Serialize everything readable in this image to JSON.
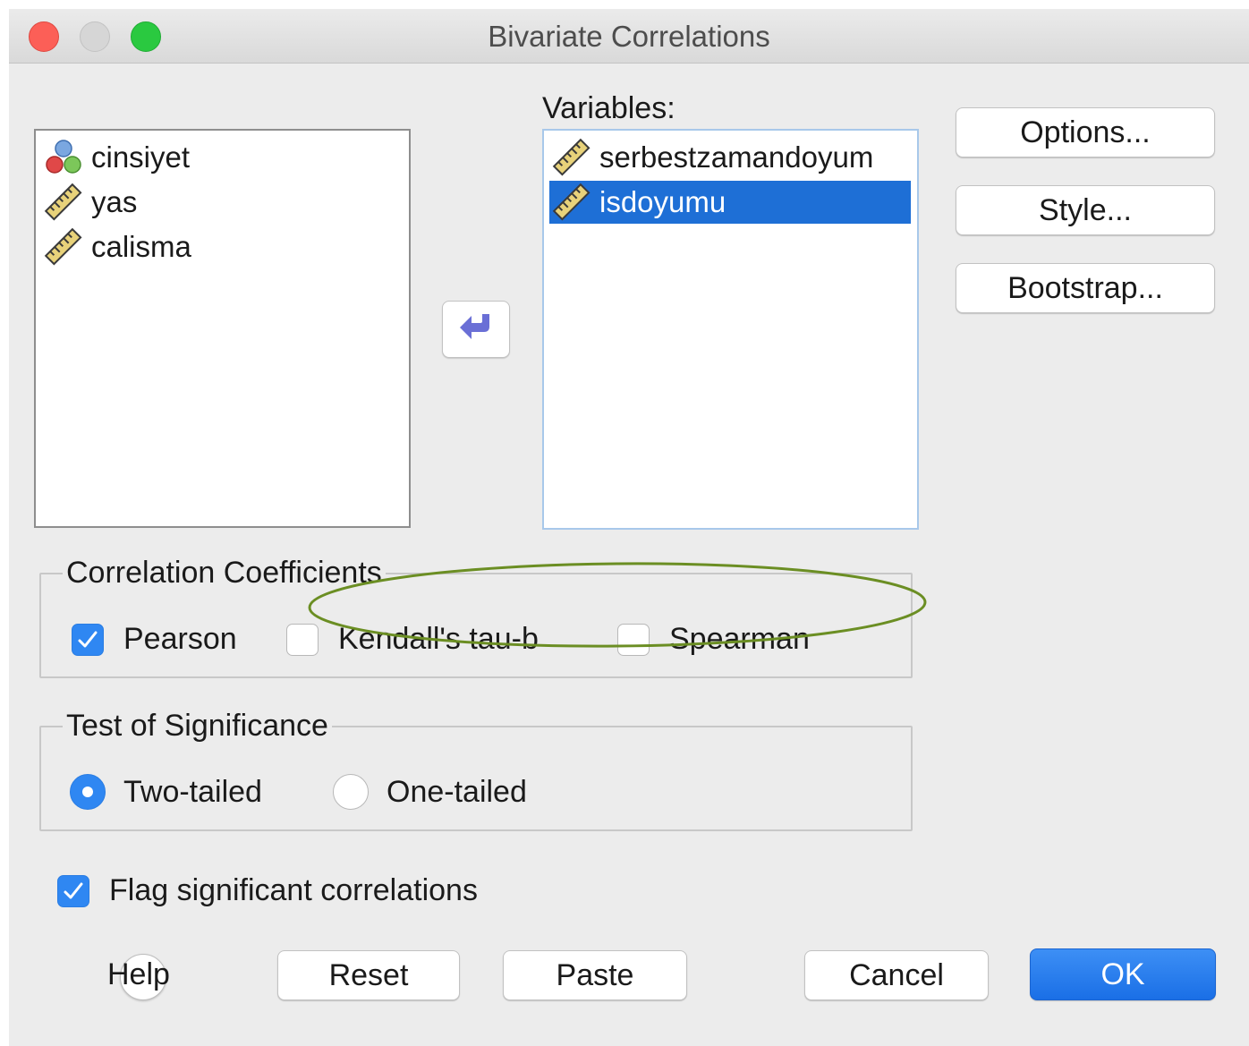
{
  "window": {
    "title": "Bivariate Correlations"
  },
  "source_list": {
    "items": [
      {
        "label": "cinsiyet",
        "icon": "nominal-variable-icon"
      },
      {
        "label": "yas",
        "icon": "scale-ruler-icon"
      },
      {
        "label": "calisma",
        "icon": "scale-ruler-icon"
      }
    ]
  },
  "variables_list": {
    "label": "Variables:",
    "items": [
      {
        "label": "serbestzamandoyum",
        "icon": "scale-ruler-icon",
        "selected": false
      },
      {
        "label": "isdoyumu",
        "icon": "scale-ruler-icon",
        "selected": true
      }
    ]
  },
  "side_buttons": {
    "options": "Options...",
    "style": "Style...",
    "bootstrap": "Bootstrap..."
  },
  "correlation_coefficients": {
    "title": "Correlation Coefficients",
    "pearson": {
      "label": "Pearson",
      "checked": true
    },
    "kendall": {
      "label": "Kendall's tau-b",
      "checked": false
    },
    "spearman": {
      "label": "Spearman",
      "checked": false
    }
  },
  "test_of_significance": {
    "title": "Test of Significance",
    "two_tailed": {
      "label": "Two-tailed",
      "selected": true
    },
    "one_tailed": {
      "label": "One-tailed",
      "selected": false
    }
  },
  "flag": {
    "label": "Flag significant correlations",
    "checked": true
  },
  "bottom_buttons": {
    "help": "Help",
    "reset": "Reset",
    "paste": "Paste",
    "cancel": "Cancel",
    "ok": "OK"
  },
  "colors": {
    "selection": "#1e6fd6",
    "accent": "#2f87f2",
    "annotation": "#6b8e23"
  }
}
